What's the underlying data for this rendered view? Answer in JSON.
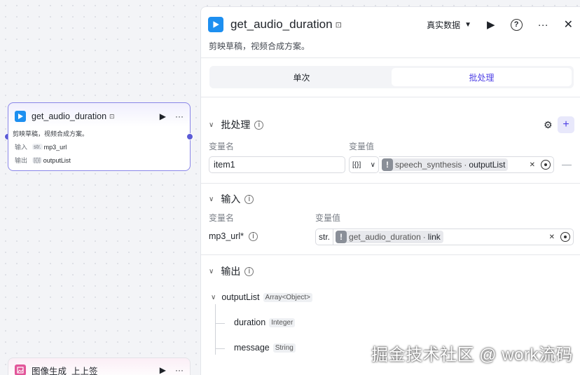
{
  "canvas": {
    "node1": {
      "title": "get_audio_duration",
      "desc": "剪映草稿，视频合成方案。",
      "input_label": "输入",
      "input_type": "str.",
      "input_value": "mp3_url",
      "output_label": "输出",
      "output_type": "[{}]",
      "output_value": "outputList"
    },
    "node2": {
      "title": "图像生成_上上签"
    }
  },
  "panel": {
    "title": "get_audio_duration",
    "description": "剪映草稿，视频合成方案。",
    "data_mode": "真实数据",
    "tabs": [
      {
        "label": "单次",
        "active": false
      },
      {
        "label": "批处理",
        "active": true
      }
    ],
    "batch": {
      "heading": "批处理",
      "col_name": "变量名",
      "col_value": "变量值",
      "var_name": "item1",
      "value_type": "[{}]",
      "ref_node": "speech_synthesis",
      "ref_field": "outputList"
    },
    "input": {
      "heading": "输入",
      "col_name": "变量名",
      "col_value": "变量值",
      "param": "mp3_url*",
      "value_type": "str.",
      "ref_node": "get_audio_duration",
      "ref_field": "link"
    },
    "output": {
      "heading": "输出",
      "root": {
        "name": "outputList",
        "type": "Array<Object>"
      },
      "children": [
        {
          "name": "duration",
          "type": "Integer"
        },
        {
          "name": "message",
          "type": "String"
        }
      ]
    }
  },
  "watermark": "掘金技术社区 @ work流码",
  "colors": {
    "accent": "#4e40e5",
    "port": "#5b5bd6",
    "logo_blue": "#1d8ff0"
  }
}
